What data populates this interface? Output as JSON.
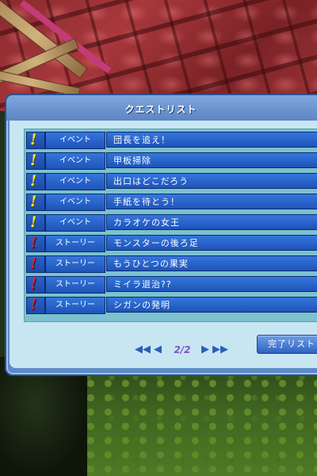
{
  "window": {
    "title": "クエストリスト",
    "page_indicator": "2/2",
    "complete_button_label": "完了リスト"
  },
  "quests": [
    {
      "type": "イベント",
      "name": "団長を追え！",
      "mark": "!",
      "mark_color": "#ffe62a"
    },
    {
      "type": "イベント",
      "name": "甲板掃除",
      "mark": "!",
      "mark_color": "#ffe62a"
    },
    {
      "type": "イベント",
      "name": "出口はどこだろう",
      "mark": "!",
      "mark_color": "#ffe62a"
    },
    {
      "type": "イベント",
      "name": "手紙を待とう！",
      "mark": "!",
      "mark_color": "#ffe62a"
    },
    {
      "type": "イベント",
      "name": "カラオケの女王",
      "mark": "!",
      "mark_color": "#ffe62a"
    },
    {
      "type": "ストーリー",
      "name": "モンスターの後ろ足",
      "mark": "!",
      "mark_color": "#e8222a"
    },
    {
      "type": "ストーリー",
      "name": "もうひとつの果実",
      "mark": "!",
      "mark_color": "#e8222a"
    },
    {
      "type": "ストーリー",
      "name": "ミイラ退治??",
      "mark": "!",
      "mark_color": "#e8222a"
    },
    {
      "type": "ストーリー",
      "name": "シガンの発明",
      "mark": "!",
      "mark_color": "#e8222a"
    }
  ],
  "icons": {
    "first_page": "double-left-arrow-icon",
    "prev_page": "left-arrow-icon",
    "next_page": "right-arrow-icon",
    "last_page": "double-right-arrow-icon",
    "event_mark": "yellow-exclamation-icon",
    "story_mark": "red-exclamation-icon"
  },
  "colors": {
    "window_blue": "#5d8ac8",
    "row_blue": "#1e54b8",
    "list_bg": "#7cc1cf",
    "page_number": "#7a55c8"
  }
}
